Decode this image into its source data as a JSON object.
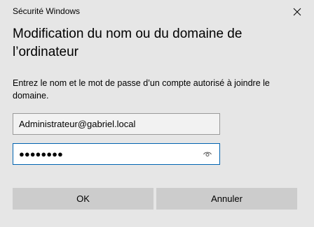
{
  "window": {
    "title": "Sécurité Windows"
  },
  "dialog": {
    "heading": "Modification du nom ou du domaine de l’ordinateur",
    "instructions": "Entrez le nom et le mot de passe d’un compte autorisé à joindre le domaine."
  },
  "form": {
    "username_value": "Administrateur@gabriel.local",
    "password_masked": "●●●●●●●●"
  },
  "buttons": {
    "ok_label": "OK",
    "cancel_label": "Annuler"
  },
  "icons": {
    "close": "close-icon",
    "reveal": "eye-icon"
  },
  "colors": {
    "background": "#e6e6e6",
    "focus_border": "#0063b1",
    "button": "#cccccc"
  }
}
